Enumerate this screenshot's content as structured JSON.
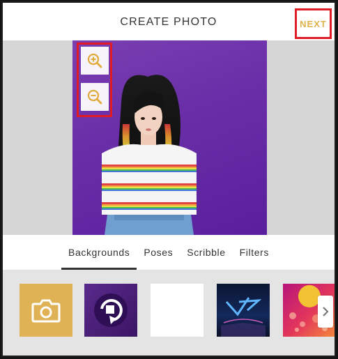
{
  "header": {
    "title": "CREATE PHOTO",
    "next_label": "NEXT"
  },
  "preview": {
    "zoom_in_icon": "zoom-in-icon",
    "zoom_out_icon": "zoom-out-icon",
    "background_color": "#6a2fa8"
  },
  "tabs": [
    {
      "label": "Backgrounds",
      "active": true
    },
    {
      "label": "Poses",
      "active": false
    },
    {
      "label": "Scribble",
      "active": false
    },
    {
      "label": "Filters",
      "active": false
    }
  ],
  "thumbnails": [
    {
      "name": "camera-icon"
    },
    {
      "name": "stop-refresh-icon"
    },
    {
      "name": "blank-white"
    },
    {
      "name": "neon-logo-night"
    },
    {
      "name": "bokeh-sunset"
    }
  ],
  "colors": {
    "accent": "#e0b24e",
    "highlight": "#e01b24",
    "tab_text": "#333333"
  }
}
